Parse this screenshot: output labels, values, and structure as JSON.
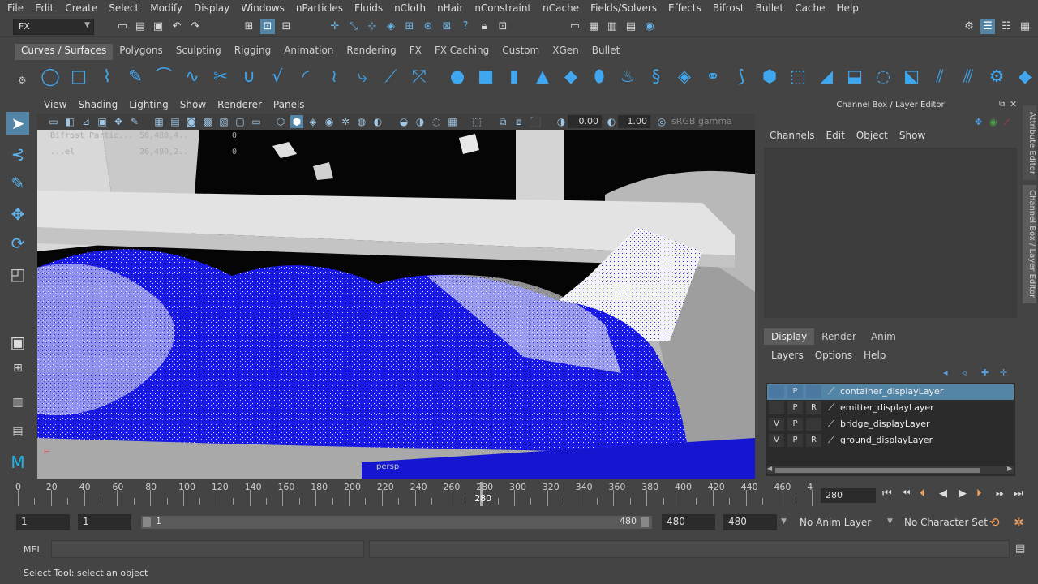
{
  "menu": [
    "File",
    "Edit",
    "Create",
    "Select",
    "Modify",
    "Display",
    "Windows",
    "nParticles",
    "Fluids",
    "nCloth",
    "nHair",
    "nConstraint",
    "nCache",
    "Fields/Solvers",
    "Effects",
    "Bifrost",
    "Bullet",
    "Cache",
    "Help"
  ],
  "status": {
    "mode": "FX"
  },
  "shelf": {
    "tabs": [
      "Curves / Surfaces",
      "Polygons",
      "Sculpting",
      "Rigging",
      "Animation",
      "Rendering",
      "FX",
      "FX Caching",
      "Custom",
      "XGen",
      "Bullet"
    ],
    "active_tab": "Curves / Surfaces"
  },
  "viewport": {
    "menu": [
      "View",
      "Shading",
      "Lighting",
      "Show",
      "Renderer",
      "Panels"
    ],
    "exposure": "0.00",
    "gamma": "1.00",
    "colorspace": "sRGB gamma",
    "hud": {
      "label1": "Bifrost Partic...",
      "value1": "58,488,4..",
      "label2": "...el",
      "value2": "26,490,2..",
      "count1": "0",
      "count2": "0"
    },
    "camera": "persp"
  },
  "channel_box": {
    "title": "Channel Box / Layer Editor",
    "menu": [
      "Channels",
      "Edit",
      "Object",
      "Show"
    ]
  },
  "layer_editor": {
    "tabs": [
      "Display",
      "Render",
      "Anim"
    ],
    "active_tab": "Display",
    "menu": [
      "Layers",
      "Options",
      "Help"
    ],
    "layers": [
      {
        "v": "",
        "p": "P",
        "r": "",
        "name": "container_displayLayer",
        "selected": true
      },
      {
        "v": "",
        "p": "P",
        "r": "R",
        "name": "emitter_displayLayer",
        "selected": false
      },
      {
        "v": "V",
        "p": "P",
        "r": "",
        "name": "bridge_displayLayer",
        "selected": false
      },
      {
        "v": "V",
        "p": "P",
        "r": "R",
        "name": "ground_displayLayer",
        "selected": false
      }
    ]
  },
  "side_tabs": [
    "Attribute Editor",
    "Channel Box / Layer Editor"
  ],
  "timeline": {
    "ticks": [
      "0",
      "20",
      "40",
      "60",
      "80",
      "100",
      "120",
      "140",
      "160",
      "180",
      "200",
      "220",
      "240",
      "260",
      "280",
      "300",
      "320",
      "340",
      "360",
      "380",
      "400",
      "420",
      "440",
      "460",
      "4"
    ],
    "current": "280",
    "current_field": "280"
  },
  "range": {
    "start": "1",
    "playback_start": "1",
    "slider_start": "1",
    "slider_end": "480",
    "playback_end": "480",
    "end": "480",
    "anim_layer": "No Anim Layer",
    "character_set": "No Character Set"
  },
  "command": {
    "label": "MEL"
  },
  "help_line": "Select Tool: select an object"
}
